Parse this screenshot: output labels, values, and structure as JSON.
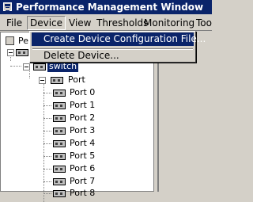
{
  "window": {
    "title": "Performance Management Window"
  },
  "menubar": {
    "items": [
      {
        "label": "File"
      },
      {
        "label": "Device"
      },
      {
        "label": "View"
      },
      {
        "label": "Thresholds"
      },
      {
        "label": "Monitoring"
      },
      {
        "label": "Too"
      }
    ]
  },
  "device_menu": {
    "items": [
      {
        "label": "Create Device Configuration File..."
      },
      {
        "label": "Delete Device..."
      }
    ]
  },
  "tree": {
    "root_label_partial": "Pe",
    "switch_label": "switch",
    "port_group_label": "Port",
    "ports": [
      "Port 0",
      "Port 1",
      "Port 2",
      "Port 3",
      "Port 4",
      "Port 5",
      "Port 6",
      "Port 7",
      "Port 8"
    ]
  }
}
